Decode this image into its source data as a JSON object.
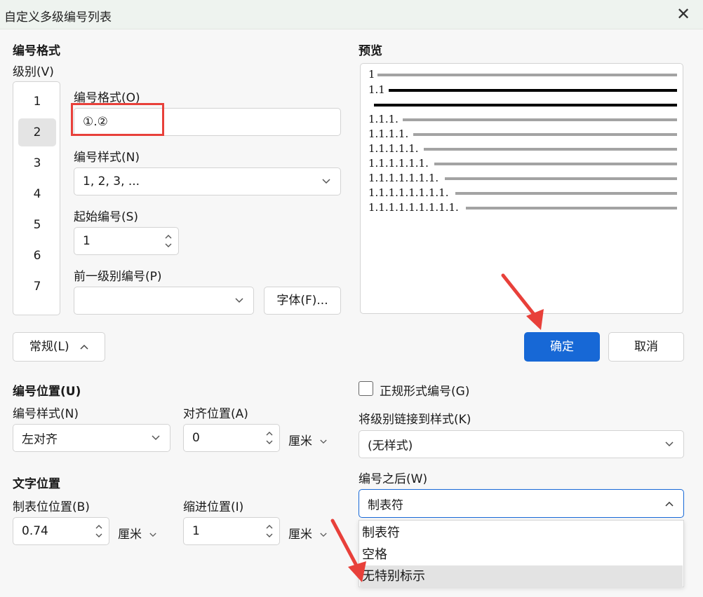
{
  "dialog": {
    "title": "自定义多级编号列表",
    "close_icon": "close-icon"
  },
  "numbering_format": {
    "section_title": "编号格式",
    "level_label": "级别(V)",
    "levels": [
      "1",
      "2",
      "3",
      "4",
      "5",
      "6",
      "7"
    ],
    "selected_level": "2",
    "format_label": "编号格式(O)",
    "format_value": "①.②",
    "style_label": "编号样式(N)",
    "style_value": "1, 2, 3, ...",
    "start_label": "起始编号(S)",
    "start_value": "1",
    "prev_level_label": "前一级别编号(P)",
    "prev_level_value": "",
    "font_button": "字体(F)..."
  },
  "preview": {
    "title": "预览",
    "rows": [
      "1",
      "1.1",
      "",
      "1.1.1.",
      "1.1.1.1.",
      "1.1.1.1.1.",
      "1.1.1.1.1.1.",
      "1.1.1.1.1.1.1.",
      "1.1.1.1.1.1.1.1.",
      "1.1.1.1.1.1.1.1.1."
    ]
  },
  "buttons": {
    "normal": "常规(L)",
    "ok": "确定",
    "cancel": "取消"
  },
  "number_position": {
    "section_title": "编号位置(U)",
    "style_label": "编号样式(N)",
    "style_value": "左对齐",
    "align_label": "对齐位置(A)",
    "align_value": "0",
    "align_unit": "厘米"
  },
  "text_position": {
    "section_title": "文字位置",
    "tab_label": "制表位位置(B)",
    "tab_value": "0.74",
    "tab_unit": "厘米",
    "indent_label": "缩进位置(I)",
    "indent_value": "1",
    "indent_unit": "厘米"
  },
  "right_options": {
    "legal_label": "正规形式编号(G)",
    "legal_checked": false,
    "link_label": "将级别链接到样式(K)",
    "link_value": "(无样式)",
    "after_label": "编号之后(W)",
    "after_value": "制表符",
    "after_options": [
      "制表符",
      "空格",
      "无特别标示"
    ],
    "after_highlighted": "无特别标示"
  },
  "colors": {
    "accent": "#1768d6",
    "annotation": "#e8403a"
  }
}
